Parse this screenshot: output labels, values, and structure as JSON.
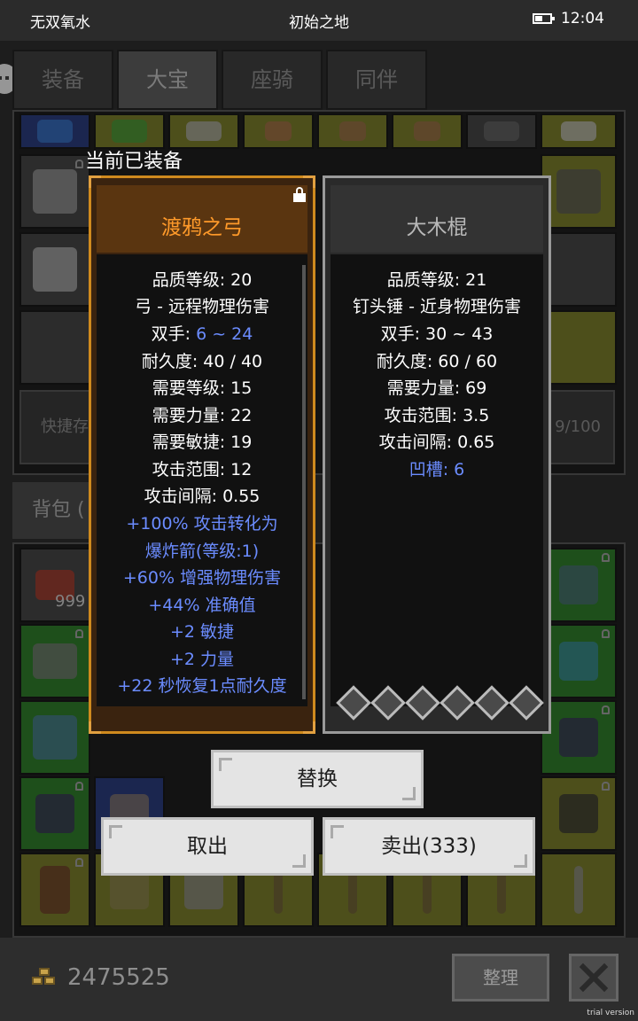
{
  "status_bar": {
    "app_name": "无双氧水",
    "location": "初始之地",
    "time": "12:04",
    "battery_icon": "battery-icon"
  },
  "tabs": [
    {
      "label": "装备",
      "active": false
    },
    {
      "label": "大宝",
      "active": true
    },
    {
      "label": "座骑",
      "active": false
    },
    {
      "label": "同伴",
      "active": false
    }
  ],
  "background": {
    "quick_store_label": "快捷存",
    "capacity_label": "9/100",
    "bag_tab_label": "背包 (",
    "stack_count": "999"
  },
  "dialog": {
    "equipped_label": "当前已装备",
    "equipped_item": {
      "name": "渡鸦之弓",
      "locked": true,
      "stats": [
        {
          "text": "品质等级: 20",
          "color": "white"
        },
        {
          "text": "弓 - 远程物理伤害",
          "color": "white"
        },
        {
          "label": "双手: ",
          "value": "6 ~ 24",
          "color": "mixed"
        },
        {
          "text": "耐久度: 40 / 40",
          "color": "white"
        },
        {
          "text": "需要等级: 15",
          "color": "white"
        },
        {
          "text": "需要力量: 22",
          "color": "white"
        },
        {
          "text": "需要敏捷: 19",
          "color": "white"
        },
        {
          "text": "攻击范围: 12",
          "color": "white"
        },
        {
          "text": "攻击间隔: 0.55",
          "color": "white"
        },
        {
          "text": "+100% 攻击转化为",
          "color": "blue"
        },
        {
          "text": "爆炸箭(等级:1)",
          "color": "blue"
        },
        {
          "text": "+60% 增强物理伤害",
          "color": "blue"
        },
        {
          "text": "+44% 准确值",
          "color": "blue"
        },
        {
          "text": "+2 敏捷",
          "color": "blue"
        },
        {
          "text": "+2 力量",
          "color": "blue"
        },
        {
          "text": "+22 秒恢复1点耐久度",
          "color": "blue"
        }
      ]
    },
    "compare_item": {
      "name": "大木棍",
      "sockets": 6,
      "stats": [
        {
          "text": "品质等级: 21",
          "color": "white"
        },
        {
          "text": "钉头锤 - 近身物理伤害",
          "color": "white"
        },
        {
          "text": "双手: 30 ~ 43",
          "color": "white"
        },
        {
          "text": "耐久度: 60 / 60",
          "color": "white"
        },
        {
          "text": "需要力量: 69",
          "color": "white"
        },
        {
          "text": "攻击范围: 3.5",
          "color": "white"
        },
        {
          "text": "攻击间隔: 0.65",
          "color": "white"
        },
        {
          "text": "凹槽: 6",
          "color": "blue"
        }
      ]
    },
    "buttons": {
      "replace": "替换",
      "take_out": "取出",
      "sell": "卖出(333)"
    }
  },
  "footer": {
    "gold": "2475525",
    "sort_label": "整理",
    "close_icon": "close-icon",
    "watermark": "trial version"
  },
  "colors": {
    "legendary_orange": "#ff9a2a",
    "magic_blue": "#6b8cff",
    "item_frame_gold": "#cf8a1e"
  }
}
